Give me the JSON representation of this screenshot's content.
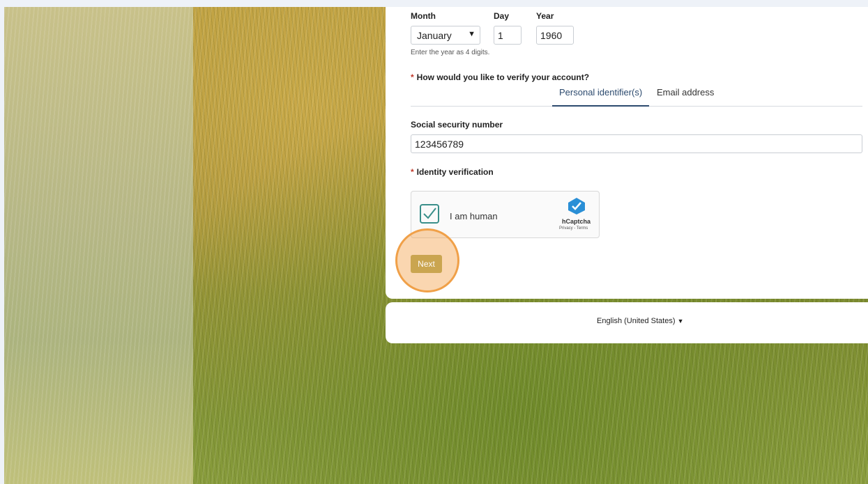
{
  "dob": {
    "month_label": "Month",
    "day_label": "Day",
    "year_label": "Year",
    "month_value": "January",
    "day_value": "1",
    "year_value": "1960",
    "year_hint": "Enter the year as 4 digits."
  },
  "verify": {
    "required_mark": "*",
    "question": "How would you like to verify your account?",
    "tabs": [
      {
        "label": "Personal identifier(s)",
        "active": true
      },
      {
        "label": "Email address",
        "active": false
      }
    ]
  },
  "ssn": {
    "label": "Social security number",
    "value": "123456789"
  },
  "identity": {
    "required_mark": "*",
    "label": "Identity verification"
  },
  "captcha": {
    "checkbox_text": "I am human",
    "brand": "hCaptcha",
    "links": "Privacy - Terms",
    "checked": true,
    "check_color": "#3a8f8a"
  },
  "actions": {
    "next_label": "Next",
    "accent": "#c5a046",
    "highlight": "#f0a048"
  },
  "footer": {
    "language": "English (United States)"
  },
  "icons": {
    "dropdown": "chevron-down-icon",
    "captcha_check": "checkmark-icon",
    "captcha_logo": "hcaptcha-logo-icon"
  }
}
